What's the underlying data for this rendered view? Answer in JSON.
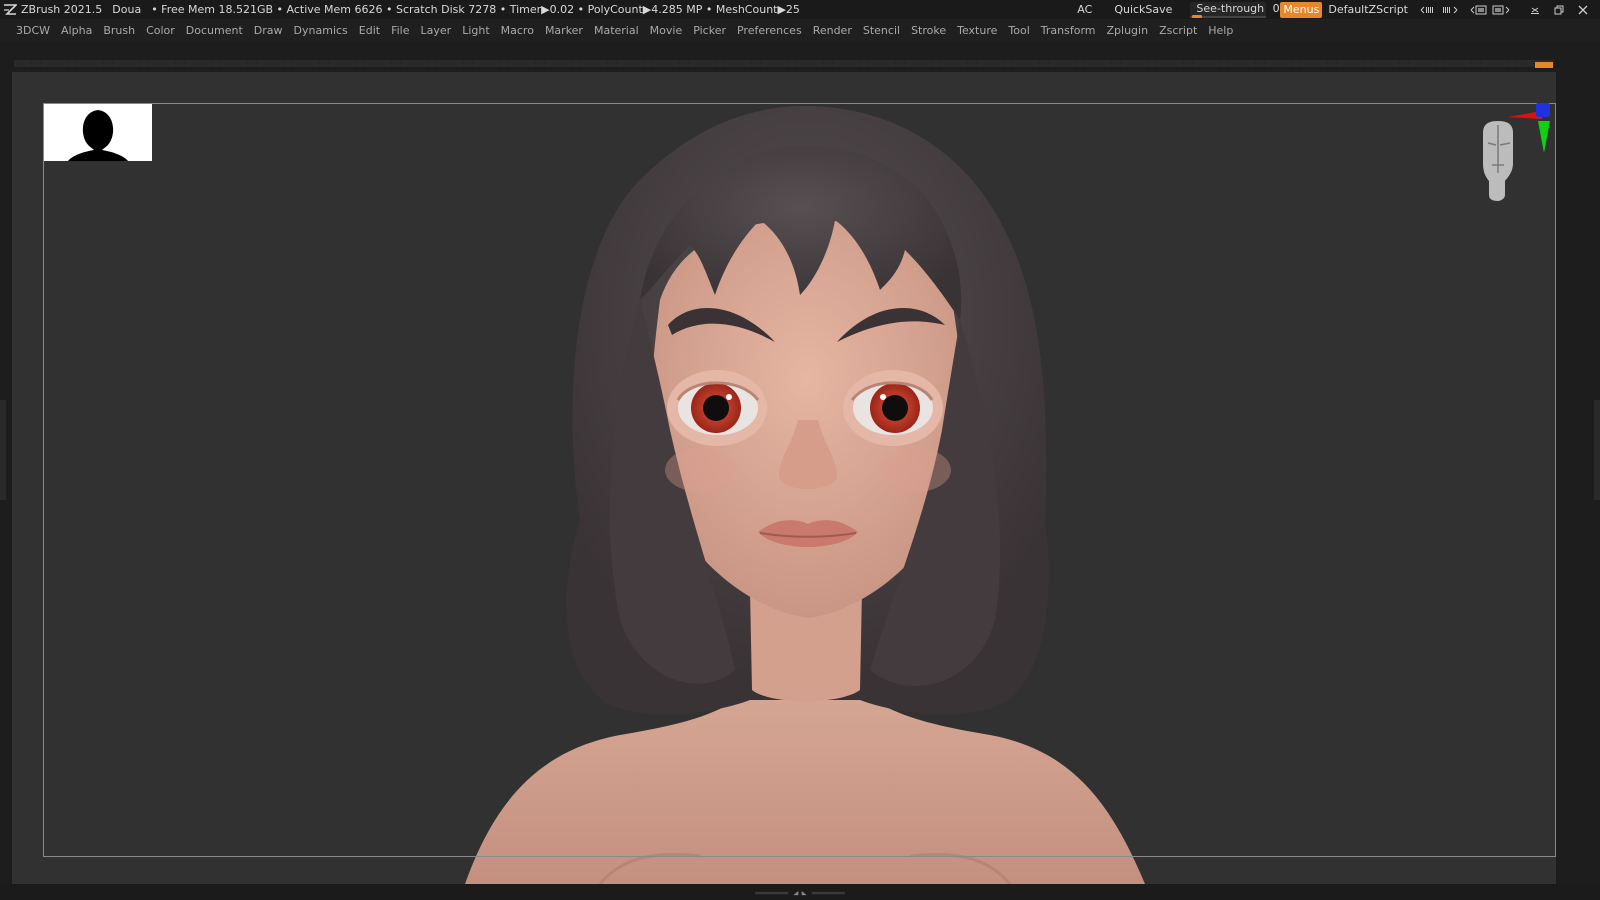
{
  "titlebar": {
    "app": "ZBrush 2021.5",
    "project": "Doua",
    "stats": "• Free Mem 18.521GB • Active Mem 6626 • Scratch Disk 7278 • Timer▶0.02 • PolyCount▶4.285 MP • MeshCount▶25",
    "ac": "AC",
    "quicksave": "QuickSave",
    "see_through_label": "See-through",
    "see_through_value": "0",
    "see_through_level": 0,
    "menus": "Menus",
    "script": "DefaultZScript",
    "accent": "#e8862a"
  },
  "menubar": {
    "items": [
      "3DCW",
      "Alpha",
      "Brush",
      "Color",
      "Document",
      "Draw",
      "Dynamics",
      "Edit",
      "File",
      "Layer",
      "Light",
      "Macro",
      "Marker",
      "Material",
      "Movie",
      "Picker",
      "Preferences",
      "Render",
      "Stencil",
      "Stroke",
      "Texture",
      "Tool",
      "Transform",
      "Zplugin",
      "Zscript",
      "Help"
    ]
  },
  "icons": {
    "logo": "zbrush-logo-icon",
    "gyro": "axis-gyro-icon",
    "head": "navigation-head-icon",
    "minimize": "minimize-icon",
    "restore": "restore-icon",
    "close": "close-icon"
  },
  "colors": {
    "viewport": "#313131",
    "hair": "#4a4143",
    "skin": "#d9a894",
    "iris": "#c0392b",
    "lips": "#c97a6c"
  }
}
